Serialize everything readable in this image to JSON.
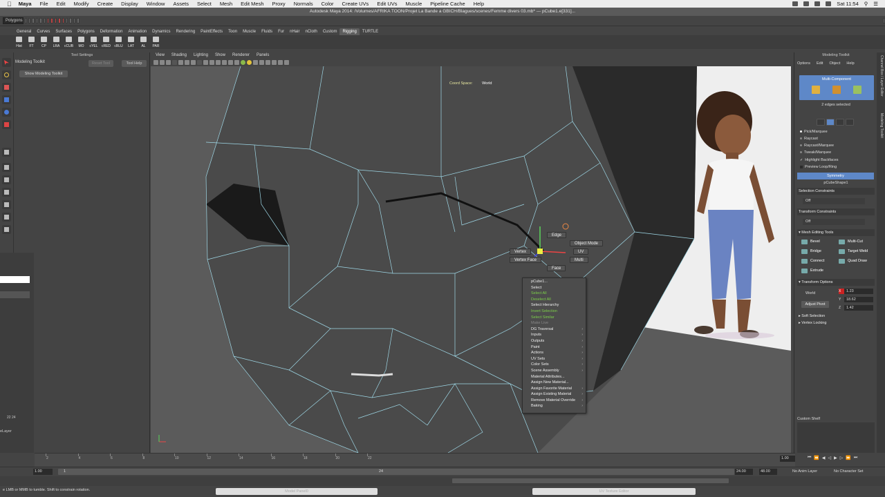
{
  "macbar": {
    "app": "Maya",
    "menus": [
      "File",
      "Edit",
      "Modify",
      "Create",
      "Display",
      "Window",
      "Assets",
      "Select",
      "Mesh",
      "Edit Mesh",
      "Proxy",
      "Normals",
      "Color",
      "Create UVs",
      "Edit UVs",
      "Muscle",
      "Pipeline Cache",
      "Help"
    ],
    "clock": "Sat 11:54"
  },
  "window_title": "Autodesk Maya 2014: /Volumes/AFRIKA TOON/Projet La Bande a GBICH/Blagues/scenes/Femme divers 03.mb*   ---   pCube1.e[331]...",
  "statusline": {
    "mode": "Polygons"
  },
  "shelf_tabs": [
    "General",
    "Curves",
    "Surfaces",
    "Polygons",
    "Deformation",
    "Animation",
    "Dynamics",
    "Rendering",
    "PaintEffects",
    "Toon",
    "Muscle",
    "Fluids",
    "Fur",
    "nHair",
    "nCloth",
    "Custom",
    "Rigging",
    "TURTLE"
  ],
  "shelf_buttons": [
    "Hist",
    "FT",
    "CP",
    "LRA",
    "cCUB",
    "MO",
    "cYEL",
    "cRED",
    "cBLU",
    "LAT",
    "AL",
    "PAR"
  ],
  "tool_settings": {
    "title": "Tool Settings",
    "tool_name": "Modeling Toolkit",
    "reset_label": "Reset Tool",
    "help_label": "Tool Help",
    "show_label": "Show Modeling Toolkit"
  },
  "viewport": {
    "menus": [
      "View",
      "Shading",
      "Lighting",
      "Show",
      "Renderer",
      "Panels"
    ],
    "coord_space_label": "Coord Space:",
    "coord_space_value": "World"
  },
  "marking_menu": {
    "edge": "Edge",
    "object_mode": "Object Mode",
    "vertex": "Vertex",
    "uv": "UV",
    "vertex_face": "Vertex Face",
    "multi": "Multi",
    "face": "Face"
  },
  "context_menu": [
    {
      "label": "pCube1...",
      "style": "normal",
      "sub": false
    },
    {
      "label": "Select",
      "style": "normal",
      "sub": false
    },
    {
      "label": "Select All",
      "style": "green",
      "sub": false
    },
    {
      "label": "Deselect All",
      "style": "green",
      "sub": false
    },
    {
      "label": "Select Hierarchy",
      "style": "normal",
      "sub": false
    },
    {
      "label": "Invert Selection",
      "style": "green",
      "sub": false
    },
    {
      "label": "Select Similar",
      "style": "green",
      "sub": false
    },
    {
      "label": "Make Live",
      "style": "dim",
      "sub": false
    },
    {
      "label": "DG Traversal",
      "style": "normal",
      "sub": true
    },
    {
      "label": "Inputs",
      "style": "normal",
      "sub": true
    },
    {
      "label": "Outputs",
      "style": "normal",
      "sub": true
    },
    {
      "label": "Paint",
      "style": "normal",
      "sub": true
    },
    {
      "label": "Actions",
      "style": "normal",
      "sub": true
    },
    {
      "label": "UV Sets",
      "style": "normal",
      "sub": true
    },
    {
      "label": "Color Sets",
      "style": "normal",
      "sub": true
    },
    {
      "label": "Scene Assembly",
      "style": "normal",
      "sub": true
    },
    {
      "label": "Material Attributes...",
      "style": "normal",
      "sub": false
    },
    {
      "label": "Assign New Material...",
      "style": "normal",
      "sub": false
    },
    {
      "label": "Assign Favorite Material",
      "style": "normal",
      "sub": true
    },
    {
      "label": "Assign Existing Material",
      "style": "normal",
      "sub": true
    },
    {
      "label": "Remove Material Override",
      "style": "normal",
      "sub": true
    },
    {
      "label": "Baking",
      "style": "normal",
      "sub": true
    }
  ],
  "modeling_toolkit": {
    "title": "Modeling Toolkit",
    "menus": [
      "Options",
      "Edit",
      "Object",
      "Help"
    ],
    "multi_component": "Multi-Component",
    "edges_selected": "2 edges selected",
    "pick_modes": [
      "Pick/Marquee",
      "Raycast",
      "Raycast/Marquee",
      "Tweak/Marquee"
    ],
    "highlight_backfaces": "Highlight Backfaces",
    "preview_loop": "Preview Loop/Ring",
    "symmetry": "Symmetry",
    "shape_name": "pCubeShape1",
    "selection_constraints": "Selection Constraints",
    "sc_value": "Off",
    "transform_constraints": "Transform Constraints",
    "tc_value": "Off",
    "mesh_editing_tools": "Mesh Editing Tools",
    "tools": [
      "Bevel",
      "Multi-Cut",
      "Bridge",
      "Target Weld",
      "Connect",
      "Quad Draw",
      "Extrude"
    ],
    "transform_options": "Transform Options",
    "world": "World",
    "adjust_pivot": "Adjust Pivot",
    "x": "1.23",
    "y": "18.62",
    "z": "1.42",
    "x_label": "X",
    "y_label": "Y",
    "z_label": "Z",
    "soft_selection": "Soft Selection",
    "vertex_locking": "Vertex Locking",
    "custom_shelf": "Custom Shelf"
  },
  "side_tabs": [
    "Channel Box / Layer Editor",
    "Modeling Toolkit"
  ],
  "timeline": {
    "ticks": [
      "2",
      "4",
      "6",
      "8",
      "10",
      "12",
      "14",
      "16",
      "18",
      "20",
      "22"
    ],
    "current_frame": "1.00",
    "range_start": "1.00",
    "range_inner_start": "1",
    "range_inner_end": "24",
    "end1": "24.00",
    "end2": "48.00",
    "anim_layer": "No Anim Layer",
    "character_set": "No Character Set"
  },
  "left_panel": {
    "layer_text": "eLayer",
    "nums": "22  24"
  },
  "help_line": "e LMB or MMB to tumble. Shift to constrain rotation.",
  "bottom_panels": [
    "Model Panel0",
    "UV Texture Editor"
  ]
}
